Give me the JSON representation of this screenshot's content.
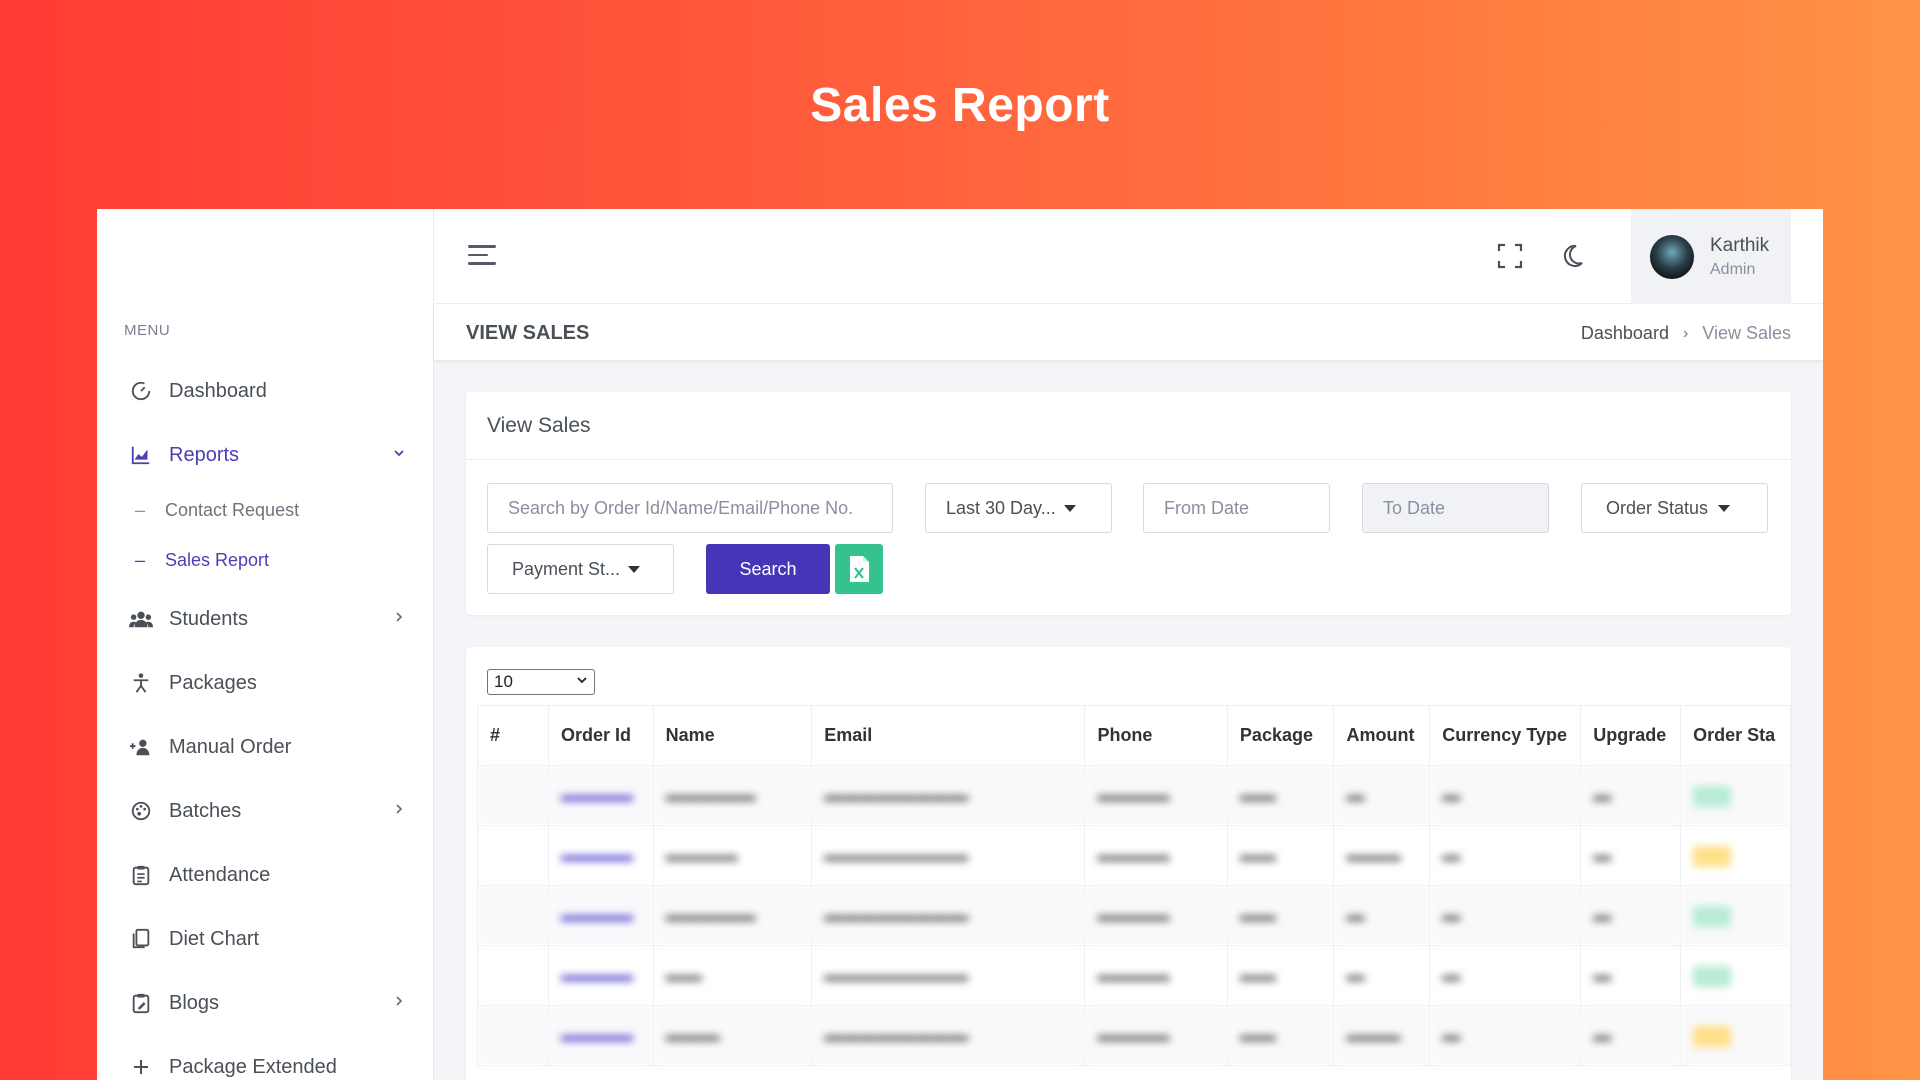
{
  "hero": {
    "title": "Sales Report"
  },
  "sidebar": {
    "menu_heading": "MENU",
    "items": [
      {
        "label": "Dashboard",
        "icon": "dashboard-gauge-icon"
      },
      {
        "label": "Reports",
        "icon": "chart-area-icon",
        "expanded": true
      },
      {
        "label": "Students",
        "icon": "users-icon"
      },
      {
        "label": "Packages",
        "icon": "person-icon"
      },
      {
        "label": "Manual Order",
        "icon": "user-add-icon"
      },
      {
        "label": "Batches",
        "icon": "palette-icon"
      },
      {
        "label": "Attendance",
        "icon": "clipboard-icon"
      },
      {
        "label": "Diet Chart",
        "icon": "document-copy-icon"
      },
      {
        "label": "Blogs",
        "icon": "clipboard-edit-icon"
      },
      {
        "label": "Package Extended",
        "icon": "plus-icon"
      }
    ],
    "sub_items": [
      {
        "label": "Contact Request"
      },
      {
        "label": "Sales Report",
        "active": true
      }
    ]
  },
  "topbar": {
    "user": {
      "name": "Karthik",
      "role": "Admin"
    }
  },
  "pagebar": {
    "title": "VIEW SALES",
    "breadcrumb": [
      "Dashboard",
      "View Sales"
    ]
  },
  "filters": {
    "title": "View Sales",
    "search_placeholder": "Search by Order Id/Name/Email/Phone No.",
    "date_range": "Last 30 Day...",
    "from_placeholder": "From Date",
    "to_placeholder": "To Date",
    "order_status": "Order Status",
    "payment_status": "Payment St...",
    "search_label": "Search"
  },
  "table": {
    "page_size": "10",
    "columns": [
      "#",
      "Order Id",
      "Name",
      "Email",
      "Phone",
      "Package",
      "Amount",
      "Currency Type",
      "Upgrade",
      "Order Sta"
    ]
  },
  "colors": {
    "accent": "#4735b8",
    "excel": "#34c38f",
    "gradient_start": "#ff3b33",
    "gradient_end": "#ff9446"
  }
}
